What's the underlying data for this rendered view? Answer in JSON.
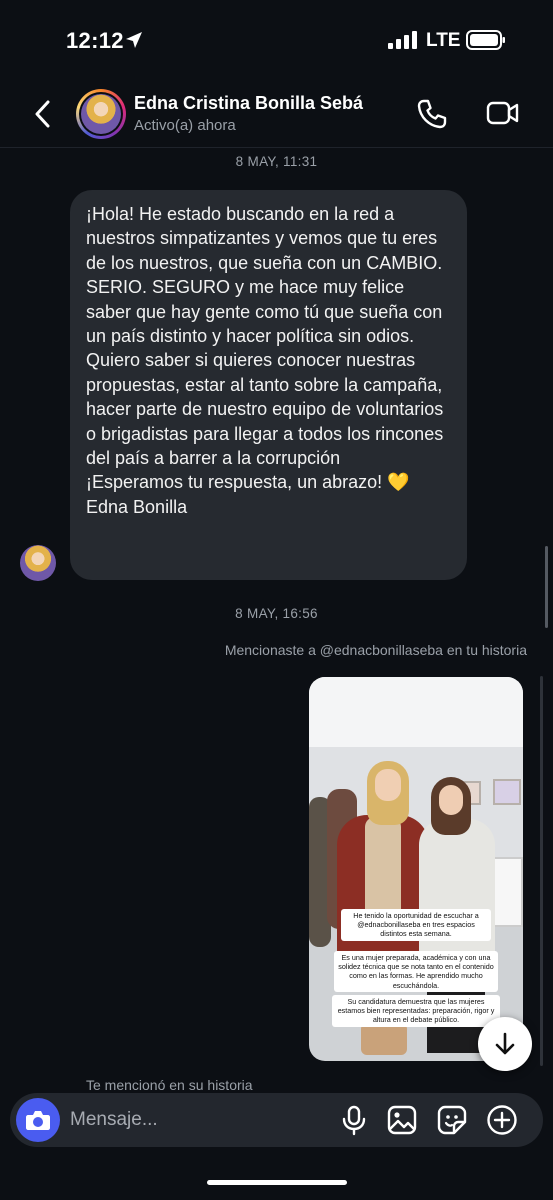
{
  "status_bar": {
    "time": "12:12",
    "network": "LTE"
  },
  "header": {
    "contact_name": "Edna Cristina Bonilla Sebá",
    "contact_status": "Activo(a) ahora"
  },
  "conversation": {
    "timestamp_1": "8 MAY, 11:31",
    "message": {
      "p1": "¡Hola! He estado buscando en la red a nuestros simpatizantes y vemos que tu eres de los nuestros, que sueña con un CAMBIO. SERIO. SEGURO  y me hace muy felice saber que hay gente como tú que sueña con un país distinto y hacer política sin odios.",
      "p2": "Quiero saber si quieres conocer nuestras propuestas, estar al tanto sobre la campaña, hacer parte de nuestro equipo de voluntarios o brigadistas para llegar a todos los rincones del país a barrer a la corrupción",
      "p3": "¡Esperamos tu respuesta, un abrazo!",
      "heart": "💛",
      "signature": "Edna Bonilla"
    },
    "timestamp_2": "8 MAY, 16:56",
    "mention_note": "Mencionaste a @ednacbonillaseba en tu historia",
    "story": {
      "caption_1": "He tenido la oportunidad de escuchar a @ednacbonillaseba en tres espacios distintos esta semana.",
      "caption_2": "Es una mujer preparada, académica y con una solidez técnica que se nota tanto en el contenido como en las formas. He aprendido mucho escuchándola.",
      "caption_3": "Su candidatura demuestra que las mujeres estamos bien representadas: preparación, rigor y altura en el debate público."
    },
    "mentioned_you": "Te mencionó en su historia"
  },
  "composer": {
    "placeholder": "Mensaje..."
  },
  "colors": {
    "background": "#0c0f14",
    "bubble": "#262a30",
    "camera_button": "#4a5cf0",
    "secondary_text": "#9aa0a8"
  },
  "icons": [
    "location-arrow-icon",
    "signal-icon",
    "battery-icon",
    "back-chevron-icon",
    "phone-icon",
    "video-camera-icon",
    "arrow-down-icon",
    "camera-icon",
    "microphone-icon",
    "gallery-icon",
    "sticker-icon",
    "plus-icon"
  ]
}
